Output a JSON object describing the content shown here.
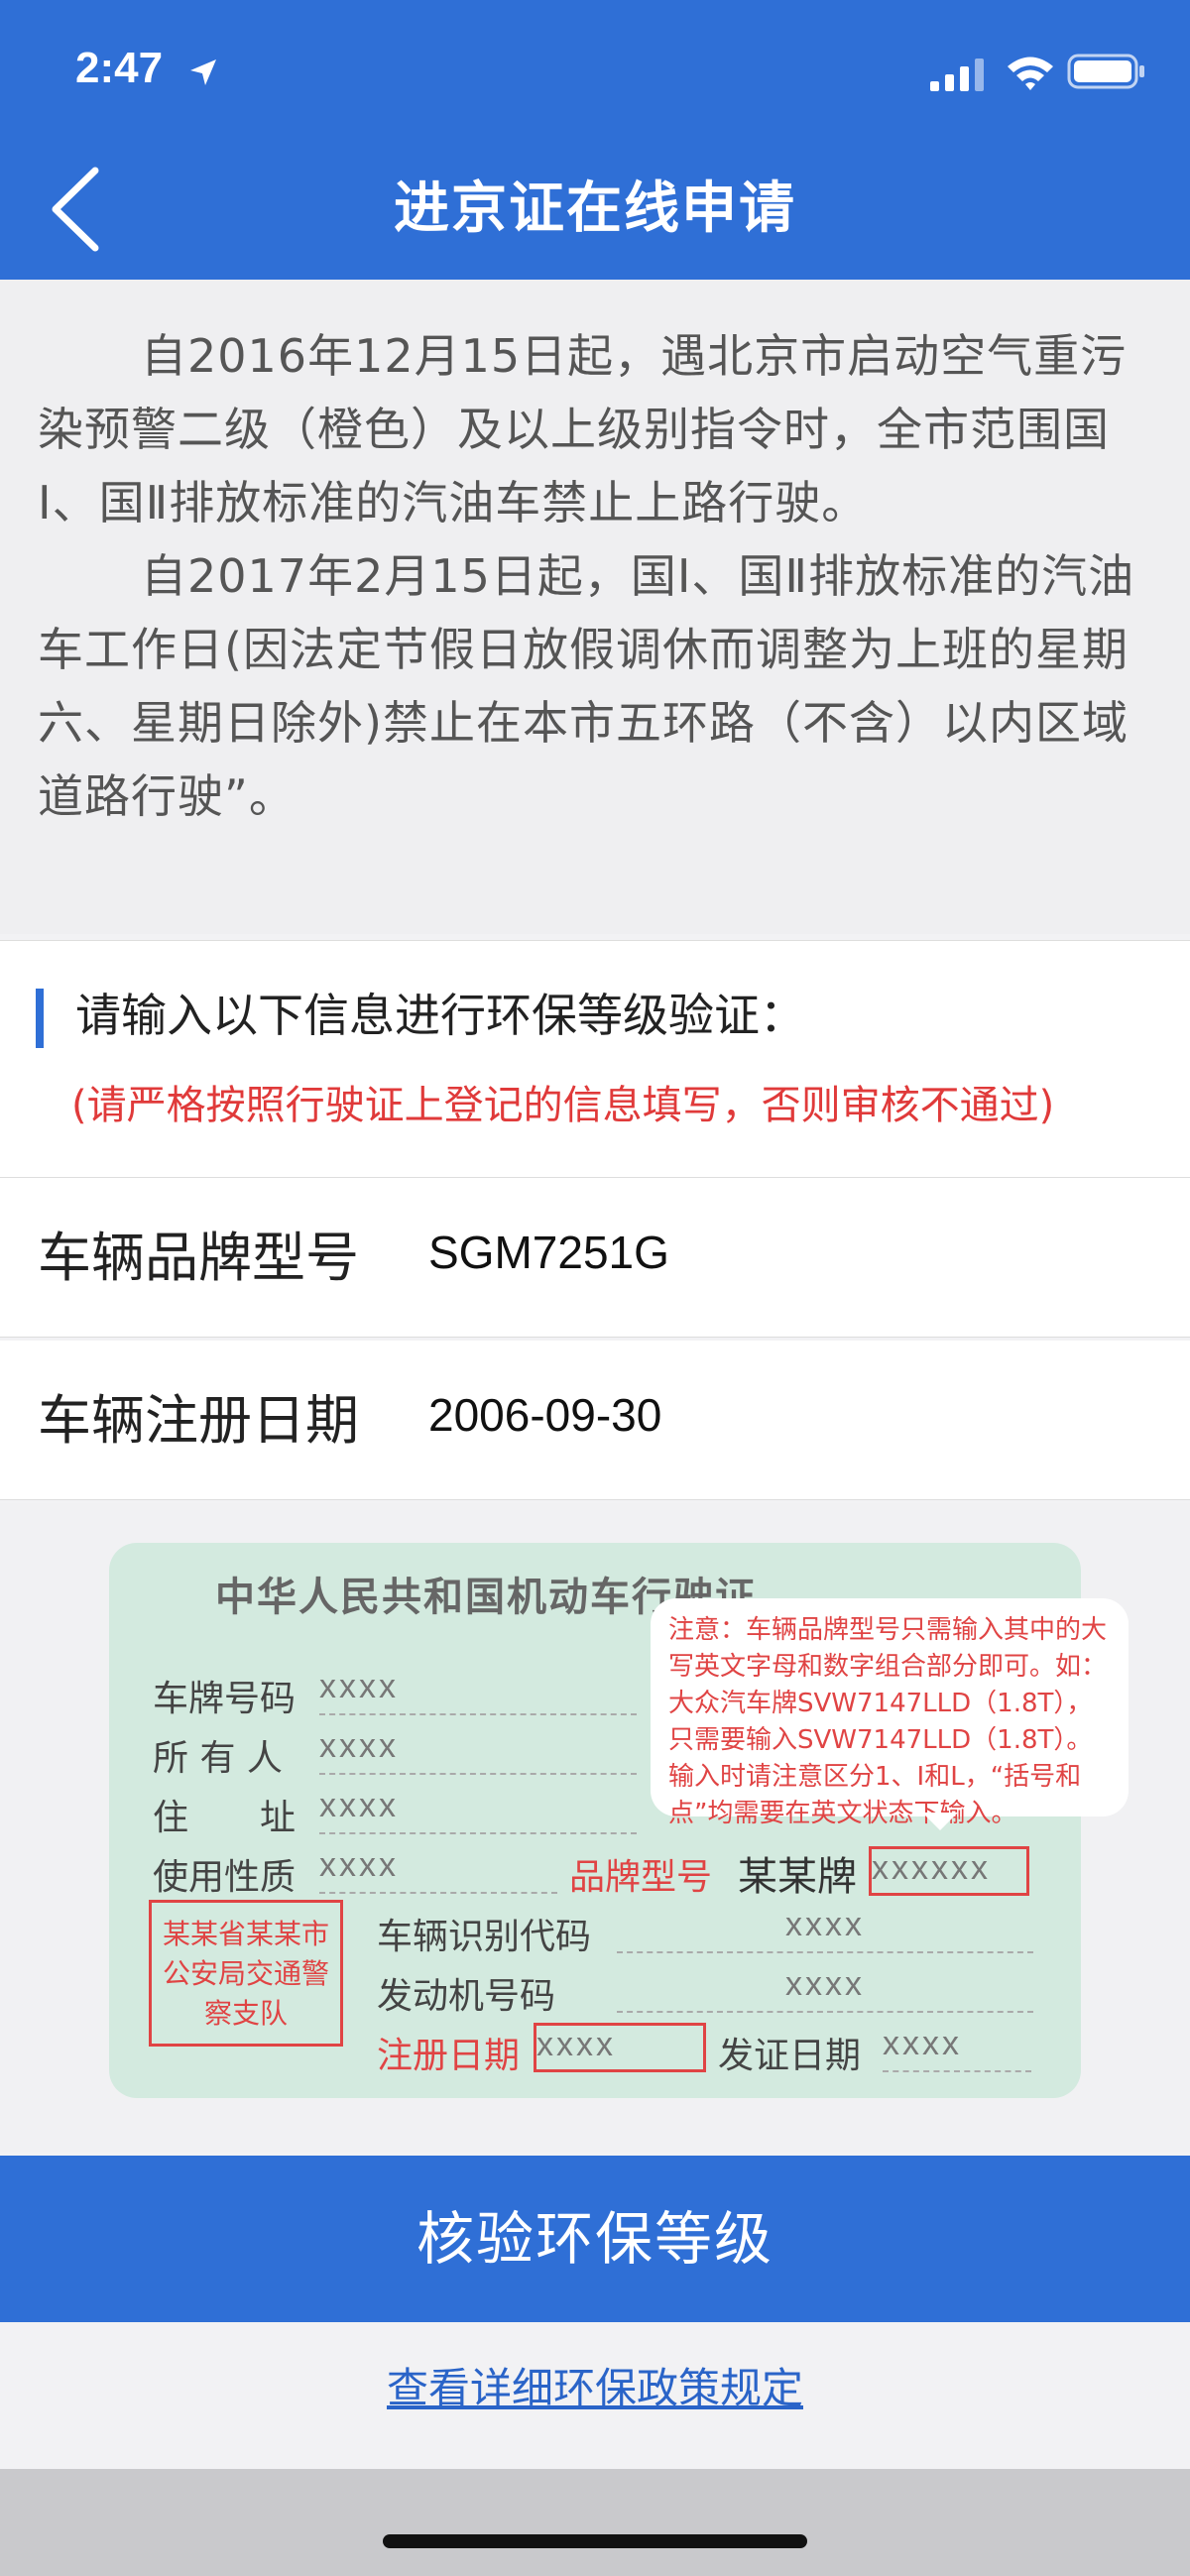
{
  "status_bar": {
    "time": "2:47",
    "icons": [
      "location-arrow-icon",
      "signal-icon",
      "wifi-icon",
      "battery-icon"
    ]
  },
  "nav": {
    "back_icon": "chevron-left-icon",
    "title": "进京证在线申请"
  },
  "notice": {
    "paragraphs": [
      "自2016年12月15日起，遇北京市启动空气重污染预警二级（橙色）及以上级别指令时，全市范围国Ⅰ、国Ⅱ排放标准的汽油车禁止上路行驶。",
      "自2017年2月15日起，国Ⅰ、国Ⅱ排放标准的汽油车工作日(因法定节假日放假调休而调整为上班的星期六、星期日除外)禁止在本市五环路（不含）以内区域道路行驶”。"
    ]
  },
  "section": {
    "title": "请输入以下信息进行环保等级验证：",
    "warning": "(请严格按照行驶证上登记的信息填写，否则审核不通过)"
  },
  "fields": {
    "brand_label": "车辆品牌型号",
    "brand_value": "SGM7251G",
    "date_label": "车辆注册日期",
    "date_value": "2006-09-30"
  },
  "sample_card": {
    "title": "中华人民共和国机动车行驶证",
    "plate_label": "车牌号码",
    "owner_label": "所 有 人",
    "address_label": "住　　址",
    "usage_label": "使用性质",
    "brand_label": "品牌型号",
    "brand_prefix": "某某牌",
    "vin_label": "车辆识别代码",
    "engine_label": "发动机号码",
    "reg_date_label": "注册日期",
    "issue_date_label": "发证日期",
    "placeholder_short": "xxxx",
    "placeholder_long": "xxxxxx",
    "stamp_text": "某某省某某市公安局交通警察支队",
    "tooltip": "注意：车辆品牌型号只需输入其中的大写英文字母和数字组合部分即可。如：大众汽车牌SVW7147LLD（1.8T），只需要输入SVW7147LLD（1.8T）。输入时请注意区分1、I和L，“括号和点”均需要在英文状态下输入。"
  },
  "actions": {
    "verify_label": "核验环保等级",
    "policy_link": "查看详细环保政策规定"
  },
  "colors": {
    "primary": "#2f6fd6",
    "warning": "#e03a3a",
    "card_bg": "#d3eadf"
  }
}
